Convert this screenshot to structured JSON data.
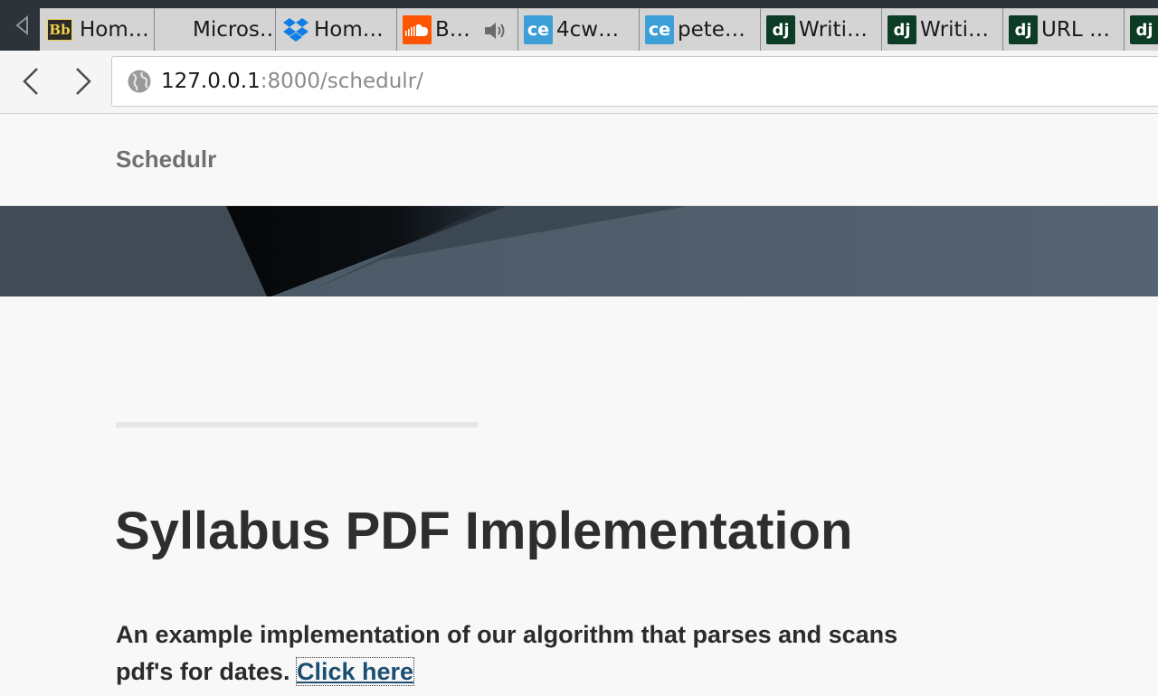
{
  "browser": {
    "tabs": [
      {
        "title": "Hom…",
        "favicon": "blackboard-icon"
      },
      {
        "title": "Micros…",
        "favicon": "none"
      },
      {
        "title": "Hom…",
        "favicon": "dropbox-icon"
      },
      {
        "title": "B…",
        "favicon": "soundcloud-icon",
        "audio": true
      },
      {
        "title": "4cw…",
        "favicon": "cloud-element-icon"
      },
      {
        "title": "pete…",
        "favicon": "cloud-element-icon"
      },
      {
        "title": "Writi…",
        "favicon": "django-icon"
      },
      {
        "title": "Writi…",
        "favicon": "django-icon"
      },
      {
        "title": "URL …",
        "favicon": "django-icon"
      },
      {
        "title": "",
        "favicon": "django-icon"
      }
    ],
    "favicon_text": {
      "blackboard": "Bb",
      "cloud_element": "ce",
      "django": "dj"
    },
    "url": {
      "host": "127.0.0.1",
      "path": ":8000/schedulr/"
    }
  },
  "site": {
    "brand": "Schedulr",
    "title": "Syllabus PDF Implementation",
    "description": "An example implementation of our algorithm that parses and scans pdf's for dates.",
    "link_text": "Click here"
  },
  "colors": {
    "tabbar_bg": "#2d3339",
    "tab_bg": "#d4d4d4",
    "page_bg": "#f8f8f8",
    "brand": "#6f6f6f",
    "title": "#2e2e2e",
    "link": "#1b4f72"
  }
}
